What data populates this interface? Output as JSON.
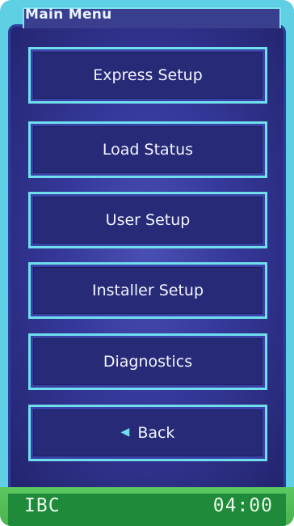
{
  "header": {
    "title": "Main Menu"
  },
  "menu": {
    "items": [
      {
        "label": "Express Setup"
      },
      {
        "label": "Load Status"
      },
      {
        "label": "User Setup"
      },
      {
        "label": "Installer Setup"
      },
      {
        "label": "Diagnostics"
      }
    ],
    "back_label": "Back",
    "back_icon": "chevron-left-icon"
  },
  "status": {
    "left_text": "IBC",
    "right_text": "04:00"
  },
  "colors": {
    "frame": "#5fd0e4",
    "screen": "#2f3290",
    "button_border": "#6fdfee",
    "status_bar": "#1f8a3a"
  }
}
